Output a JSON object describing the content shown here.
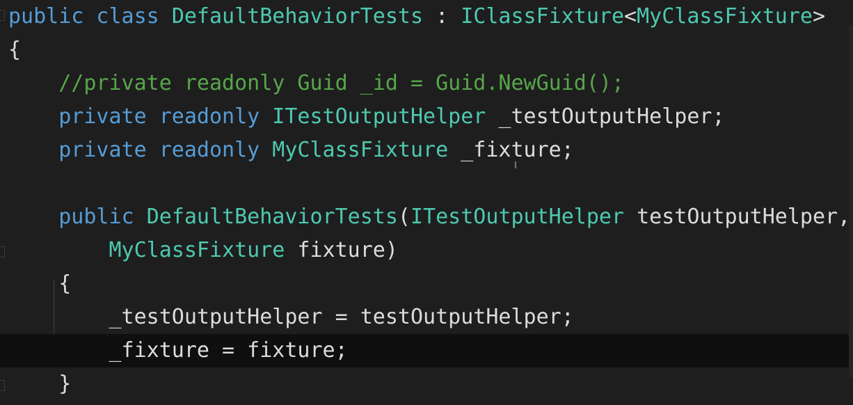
{
  "theme": {
    "background": "#1e1e1e",
    "current_line": "#0f0f0f",
    "keyword": "#569cd6",
    "type": "#4ec9b0",
    "comment": "#57a64a",
    "plain": "#dcdcdc"
  },
  "editor": {
    "current_line_index": 10,
    "lines": [
      {
        "tokens": [
          {
            "t": "public class ",
            "c": "keyword"
          },
          {
            "t": "DefaultBehaviorTests",
            "c": "type"
          },
          {
            "t": " : ",
            "c": "plain"
          },
          {
            "t": "IClassFixture",
            "c": "type"
          },
          {
            "t": "<",
            "c": "plain"
          },
          {
            "t": "MyClassFixture",
            "c": "type"
          },
          {
            "t": ">",
            "c": "plain"
          }
        ]
      },
      {
        "tokens": [
          {
            "t": "{",
            "c": "plain"
          }
        ]
      },
      {
        "tokens": [
          {
            "t": "    //private readonly Guid _id = Guid.NewGuid();",
            "c": "comment"
          }
        ]
      },
      {
        "tokens": [
          {
            "t": "    private readonly ",
            "c": "keyword"
          },
          {
            "t": "ITestOutputHelper",
            "c": "type"
          },
          {
            "t": " _testOutputHelper;",
            "c": "plain"
          }
        ]
      },
      {
        "tokens": [
          {
            "t": "    private readonly ",
            "c": "keyword"
          },
          {
            "t": "MyClassFixture",
            "c": "type"
          },
          {
            "t": " _fixture;",
            "c": "plain"
          }
        ]
      },
      {
        "tokens": []
      },
      {
        "tokens": [
          {
            "t": "    public ",
            "c": "keyword"
          },
          {
            "t": "DefaultBehaviorTests",
            "c": "type"
          },
          {
            "t": "(",
            "c": "plain"
          },
          {
            "t": "ITestOutputHelper",
            "c": "type"
          },
          {
            "t": " testOutputHelper,",
            "c": "plain"
          }
        ]
      },
      {
        "tokens": [
          {
            "t": "        ",
            "c": "plain"
          },
          {
            "t": "MyClassFixture",
            "c": "type"
          },
          {
            "t": " fixture)",
            "c": "plain"
          }
        ]
      },
      {
        "tokens": [
          {
            "t": "    {",
            "c": "plain"
          }
        ]
      },
      {
        "tokens": [
          {
            "t": "        _testOutputHelper = testOutputHelper;",
            "c": "plain"
          }
        ]
      },
      {
        "tokens": [
          {
            "t": "        _fixture = fixture;",
            "c": "plain"
          }
        ]
      },
      {
        "tokens": [
          {
            "t": "    }",
            "c": "plain"
          }
        ]
      }
    ]
  }
}
